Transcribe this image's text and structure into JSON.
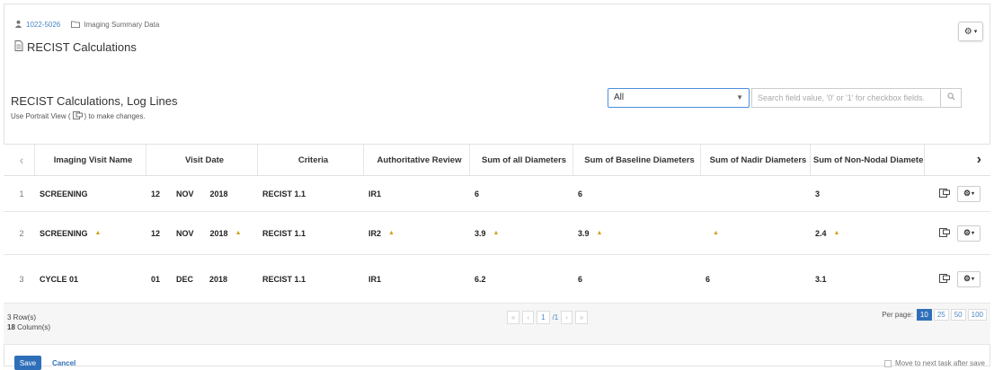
{
  "breadcrumb": {
    "patient_id": "1022-5026",
    "section": "Imaging Summary Data"
  },
  "page": {
    "title": "RECIST Calculations"
  },
  "list": {
    "title": "RECIST Calculations, Log Lines",
    "hint_prefix": "Use Portrait View (",
    "hint_suffix": ") to make changes."
  },
  "filter": {
    "value": "All"
  },
  "search": {
    "placeholder": "Search field value, '0' or '1' for checkbox fields."
  },
  "table": {
    "columns": [
      "Imaging Visit Name",
      "Visit Date",
      "Criteria",
      "Authoritative Review",
      "Sum of all Diameters",
      "Sum of Baseline Diameters",
      "Sum of Nadir Diameters",
      "Sum of Non-Nodal Diameter"
    ],
    "rows": [
      {
        "index": "1",
        "visit": "SCREENING",
        "day": "12",
        "month": "NOV",
        "year": "2018",
        "criteria": "RECIST 1.1",
        "review": "IR1",
        "sum_all": "6",
        "sum_baseline": "6",
        "sum_nadir": "",
        "sum_nonnodal": "3"
      },
      {
        "index": "2",
        "visit": "SCREENING",
        "day": "12",
        "month": "NOV",
        "year": "2018",
        "criteria": "RECIST 1.1",
        "review": "IR2",
        "sum_all": "3.9",
        "sum_baseline": "3.9",
        "sum_nadir": "",
        "sum_nonnodal": "2.4"
      },
      {
        "index": "3",
        "visit": "CYCLE 01",
        "day": "01",
        "month": "DEC",
        "year": "2018",
        "criteria": "RECIST 1.1",
        "review": "IR1",
        "sum_all": "6.2",
        "sum_baseline": "6",
        "sum_nadir": "6",
        "sum_nonnodal": "3.1"
      }
    ]
  },
  "footer": {
    "rows": "3 Row(s)",
    "columns_count": "18",
    "columns_label": "Column(s)",
    "page_current": "1",
    "page_total": "/1",
    "per_page_label": "Per page:",
    "per_page_options": [
      "10",
      "25",
      "50",
      "100"
    ]
  },
  "actions": {
    "save": "Save",
    "cancel": "Cancel",
    "move_next": "Move to next task after save"
  },
  "colors": {
    "accent": "#2f6fba",
    "warning_marker": "#d3a11e"
  }
}
